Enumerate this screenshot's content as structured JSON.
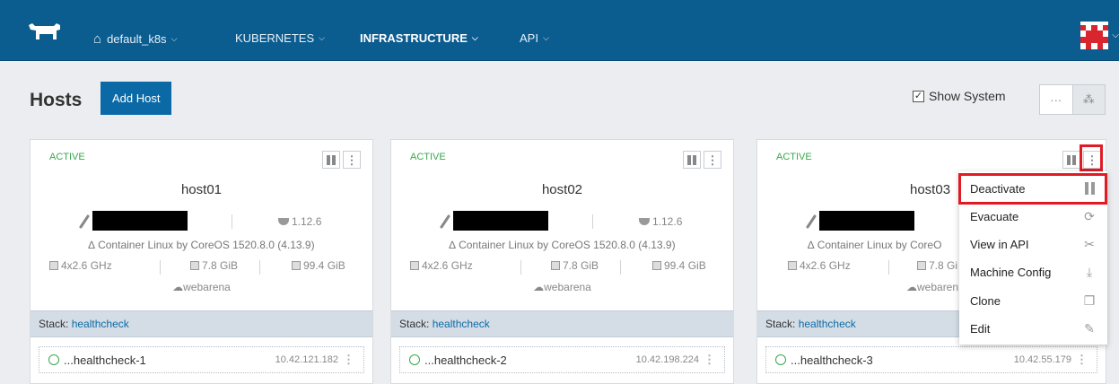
{
  "nav": {
    "environment": "default_k8s",
    "items": [
      {
        "label": "KUBERNETES",
        "active": false
      },
      {
        "label": "INFRASTRUCTURE",
        "active": true
      },
      {
        "label": "API",
        "active": false
      }
    ]
  },
  "header": {
    "title": "Hosts",
    "add_button": "Add Host",
    "show_system_label": "Show System",
    "show_system_checked": true
  },
  "hosts": [
    {
      "state": "ACTIVE",
      "name": "host01",
      "docker_version": "1.12.6",
      "os": "Container Linux by CoreOS 1520.8.0 (4.13.9)",
      "cpu": "4x2.6 GHz",
      "memory": "7.8 GiB",
      "storage": "99.4 GiB",
      "provider": "webarena",
      "stack_label": "Stack:",
      "stack_name": "healthcheck",
      "container_name": "...healthcheck-1",
      "container_ip": "10.42.121.182"
    },
    {
      "state": "ACTIVE",
      "name": "host02",
      "docker_version": "1.12.6",
      "os": "Container Linux by CoreOS 1520.8.0 (4.13.9)",
      "cpu": "4x2.6 GHz",
      "memory": "7.8 GiB",
      "storage": "99.4 GiB",
      "provider": "webarena",
      "stack_label": "Stack:",
      "stack_name": "healthcheck",
      "container_name": "...healthcheck-2",
      "container_ip": "10.42.198.224"
    },
    {
      "state": "ACTIVE",
      "name": "host03",
      "os": "Container Linux by CoreO",
      "memory": "7.8 Gi",
      "cpu": "4x2.6 GHz",
      "provider": "webaren",
      "stack_label": "Stack:",
      "stack_name": "healthcheck",
      "container_name": "...healthcheck-3",
      "container_ip": "10.42.55.179"
    }
  ],
  "menu": {
    "items": [
      {
        "label": "Deactivate",
        "icon": "pause-icon"
      },
      {
        "label": "Evacuate",
        "icon": "evacuate-icon"
      },
      {
        "label": "View in API",
        "icon": "api-icon"
      },
      {
        "label": "Machine Config",
        "icon": "download-icon"
      },
      {
        "label": "Clone",
        "icon": "clone-icon"
      },
      {
        "label": "Edit",
        "icon": "pencil-icon"
      }
    ]
  },
  "colors": {
    "nav_bg": "#0b5c8f",
    "primary": "#0b6aa6",
    "active_state": "#3aa84d",
    "highlight": "#e01b24"
  }
}
